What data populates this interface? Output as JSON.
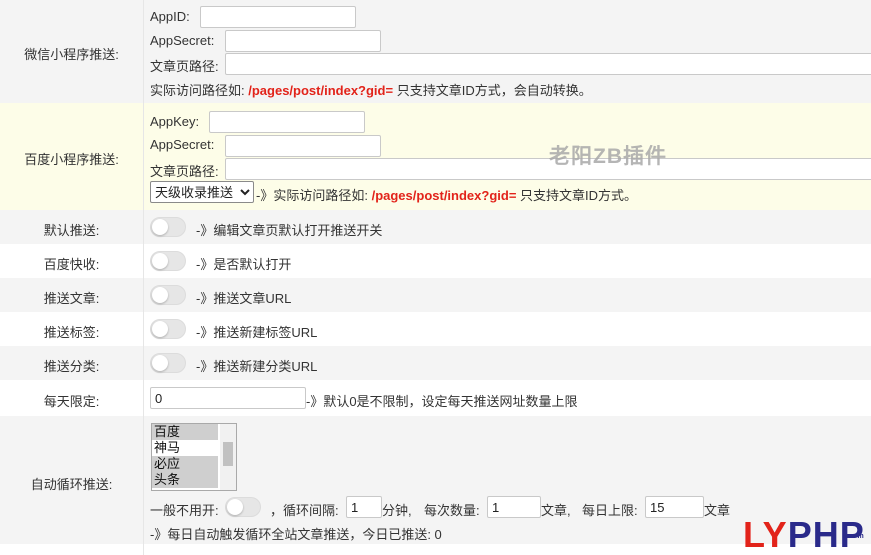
{
  "wechat": {
    "label": "微信小程序推送:",
    "appid_label": "AppID:",
    "appsecret_label": "AppSecret:",
    "path_label": "文章页路径:",
    "hint_prefix": "实际访问路径如:",
    "hint_path": "/pages/post/index?gid=",
    "hint_suffix": "只支持文章ID方式，会自动转换。"
  },
  "baidu_mini": {
    "label": "百度小程序推送:",
    "appkey_label": "AppKey:",
    "appsecret_label": "AppSecret:",
    "path_label": "文章页路径:",
    "select_value": "天级收录推送",
    "hint_prefix": "-》实际访问路径如:",
    "hint_path": "/pages/post/index?gid=",
    "hint_suffix": "只支持文章ID方式。"
  },
  "watermark": "老阳ZB插件",
  "toggles": [
    {
      "label": "默认推送:",
      "desc": "-》编辑文章页默认打开推送开关",
      "on": false
    },
    {
      "label": "百度快收:",
      "desc": "-》是否默认打开",
      "on": false
    },
    {
      "label": "推送文章:",
      "desc": "-》推送文章URL",
      "on": false
    },
    {
      "label": "推送标签:",
      "desc": "-》推送新建标签URL",
      "on": false
    },
    {
      "label": "推送分类:",
      "desc": "-》推送新建分类URL",
      "on": false
    }
  ],
  "daily_limit": {
    "label": "每天限定:",
    "value": "0",
    "desc": "-》默认0是不限制，设定每天推送网址数量上限"
  },
  "auto_loop": {
    "label": "自动循环推送:",
    "options": [
      {
        "text": "百度",
        "selected": true
      },
      {
        "text": "神马",
        "selected": false
      },
      {
        "text": "必应",
        "selected": true
      },
      {
        "text": "头条",
        "selected": true
      }
    ],
    "normally_off_label": "一般不用开:",
    "interval_label": "，循环间隔:",
    "interval_value": "1",
    "interval_unit": "分钟,",
    "per_batch_label": "每次数量:",
    "per_batch_value": "1",
    "per_batch_unit": "文章,",
    "daily_max_label": "每日上限:",
    "daily_max_value": "15",
    "daily_max_unit": "文章",
    "status": "-》每日自动触发循环全站文章推送，今日已推送: 0"
  },
  "logo": {
    "part1": "LY",
    "part2": "PHP",
    "suffix": ".com"
  },
  "colors": {
    "accent_red": "#e2231a",
    "yellow_row": "#fdfde8",
    "gray_row": "#f4f4f4"
  }
}
